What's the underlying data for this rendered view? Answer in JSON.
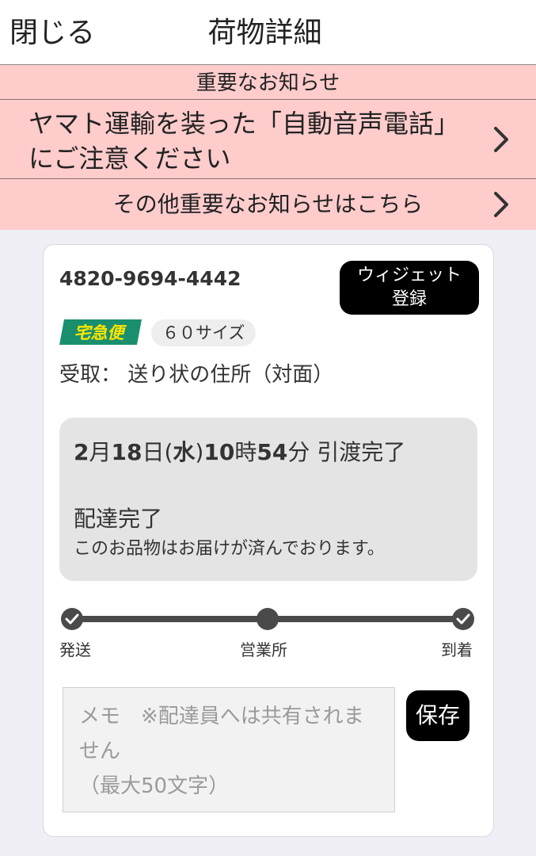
{
  "header": {
    "close_label": "閉じる",
    "title": "荷物詳細"
  },
  "notice": {
    "title": "重要なお知らせ",
    "item_text": "ヤマト運輸を装った「自動音声電話」にご注意ください",
    "more_text": "その他重要なお知らせはこちら"
  },
  "package": {
    "tracking_number": "4820-9694-4442",
    "widget_label_line1": "ウィジェット",
    "widget_label_line2": "登録",
    "service_name": "宅急便",
    "size": "６０サイズ",
    "receive_label": "受取：",
    "receive_value": "送り状の住所（対面）"
  },
  "status": {
    "date_month": "2",
    "date_day": "18",
    "date_weekday": "水",
    "date_hour": "10",
    "date_minute": "54",
    "event": "引渡完了",
    "main": "配達完了",
    "sub": "このお品物はお届けが済んでおります。"
  },
  "progress": {
    "steps": [
      "発送",
      "営業所",
      "到着"
    ],
    "completed": [
      true,
      false,
      true
    ]
  },
  "memo": {
    "placeholder": "メモ　※配達員へは共有されません\n（最大50文字）",
    "save_label": "保存"
  },
  "colors": {
    "notice_bg": "#ffcccc",
    "service_green": "#1a8f6e",
    "service_yellow": "#ffe600"
  }
}
